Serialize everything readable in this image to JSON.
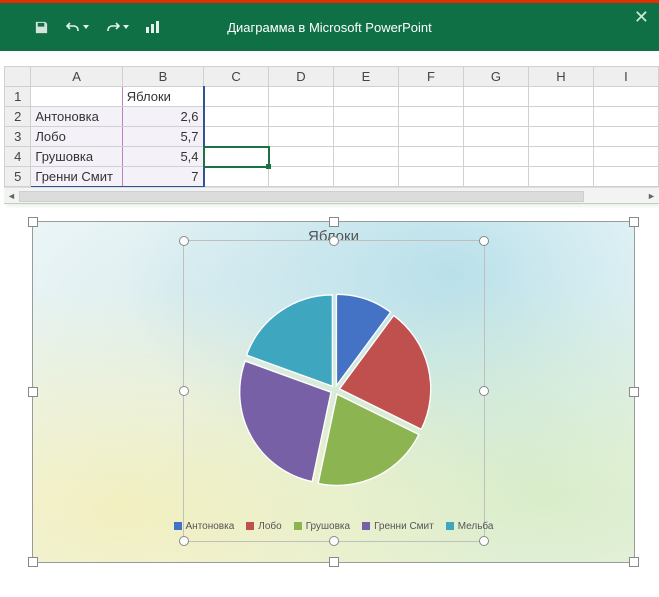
{
  "titlebar": {
    "title": "Диаграмма в Microsoft PowerPoint"
  },
  "columns": [
    "A",
    "B",
    "C",
    "D",
    "E",
    "F",
    "G",
    "H",
    "I"
  ],
  "rows": [
    "1",
    "2",
    "3",
    "4",
    "5"
  ],
  "header_label": "Яблоки",
  "data_rows": [
    {
      "label": "Антоновка",
      "value": "2,6"
    },
    {
      "label": "Лобо",
      "value": "5,7"
    },
    {
      "label": "Грушовка",
      "value": "5,4"
    },
    {
      "label": "Гренни Смит",
      "value": "7"
    }
  ],
  "chart_title": "Яблоки",
  "legend": [
    {
      "name": "Антоновка",
      "color": "#4472c4"
    },
    {
      "name": "Лобо",
      "color": "#c0504d"
    },
    {
      "name": "Грушовка",
      "color": "#8cb450"
    },
    {
      "name": "Гренни Смит",
      "color": "#7760a6"
    },
    {
      "name": "Мельба",
      "color": "#3fa6c0"
    }
  ],
  "chart_data": {
    "type": "pie",
    "title": "Яблоки",
    "series": [
      {
        "name": "Антоновка",
        "value": 2.6,
        "color": "#4472c4"
      },
      {
        "name": "Лобо",
        "value": 5.7,
        "color": "#c0504d"
      },
      {
        "name": "Грушовка",
        "value": 5.4,
        "color": "#8cb450"
      },
      {
        "name": "Гренни Смит",
        "value": 7.0,
        "color": "#7760a6"
      },
      {
        "name": "Мельба",
        "value": 5.0,
        "color": "#3fa6c0"
      }
    ]
  }
}
